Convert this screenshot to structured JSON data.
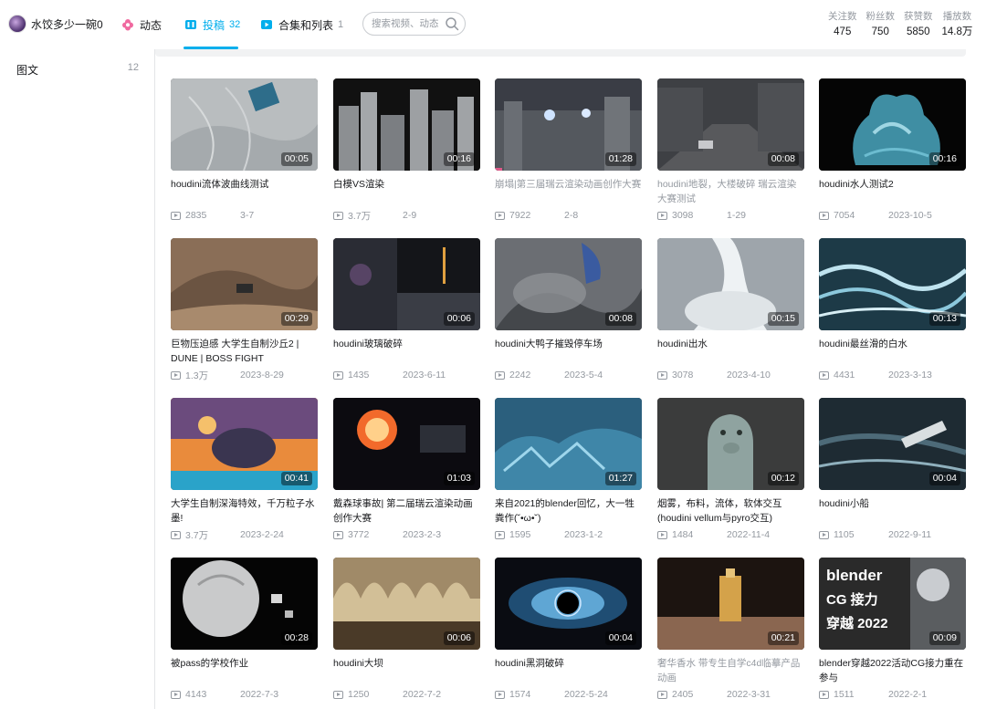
{
  "header": {
    "user_name": "水饺多少一碗0",
    "nav": [
      {
        "label": "动态",
        "count": ""
      },
      {
        "label": "投稿",
        "count": "32"
      },
      {
        "label": "合集和列表",
        "count": "1"
      }
    ],
    "search_placeholder": "搜索视频、动态",
    "stats": [
      {
        "label": "关注数",
        "value": "475"
      },
      {
        "label": "粉丝数",
        "value": "750"
      },
      {
        "label": "获赞数",
        "value": "5850"
      },
      {
        "label": "播放数",
        "value": "14.8万"
      }
    ],
    "colors": {
      "accent": "#00aeec",
      "secondary_text": "#9499a0"
    }
  },
  "sidebar": {
    "items": [
      {
        "label": "图文",
        "count": "12"
      }
    ]
  },
  "videos": [
    {
      "title": "houdini流体波曲线测试",
      "duration": "00:05",
      "views": "2835",
      "date": "3-7"
    },
    {
      "title": "白模VS渲染",
      "duration": "00:16",
      "views": "3.7万",
      "date": "2-9"
    },
    {
      "title": "崩塌|第三届瑞云渲染动画创作大赛",
      "duration": "01:28",
      "views": "7922",
      "date": "2-8"
    },
    {
      "title": "houdini地裂，大楼破碎 瑞云渲染大赛测试",
      "duration": "00:08",
      "views": "3098",
      "date": "1-29"
    },
    {
      "title": "houdini水人测试2",
      "duration": "00:16",
      "views": "7054",
      "date": "2023-10-5"
    },
    {
      "title": "巨物压迫感 大学生自制沙丘2 | DUNE | BOSS FIGHT",
      "duration": "00:29",
      "views": "1.3万",
      "date": "2023-8-29"
    },
    {
      "title": "houdini玻璃破碎",
      "duration": "00:06",
      "views": "1435",
      "date": "2023-6-11"
    },
    {
      "title": "houdini大鸭子摧毁停车场",
      "duration": "00:08",
      "views": "2242",
      "date": "2023-5-4"
    },
    {
      "title": "houdini出水",
      "duration": "00:15",
      "views": "3078",
      "date": "2023-4-10"
    },
    {
      "title": "houdini最丝滑的白水",
      "duration": "00:13",
      "views": "4431",
      "date": "2023-3-13"
    },
    {
      "title": "大学生自制深海特效，千万粒子水墨!",
      "duration": "00:41",
      "views": "3.7万",
      "date": "2023-2-24"
    },
    {
      "title": "戴森球事故| 第二届瑞云渲染动画创作大赛",
      "duration": "01:03",
      "views": "3772",
      "date": "2023-2-3"
    },
    {
      "title": "来自2021的blender回忆，大一牲粪作(˘•ω•˘)",
      "duration": "01:27",
      "views": "1595",
      "date": "2023-1-2"
    },
    {
      "title": "烟雾，布料，流体，软体交互(houdini vellum与pyro交互)",
      "duration": "00:12",
      "views": "1484",
      "date": "2022-11-4"
    },
    {
      "title": "houdini小船",
      "duration": "00:04",
      "views": "1105",
      "date": "2022-9-11"
    },
    {
      "title": "被pass的学校作业",
      "duration": "00:28",
      "views": "4143",
      "date": "2022-7-3"
    },
    {
      "title": "houdini大坝",
      "duration": "00:06",
      "views": "1250",
      "date": "2022-7-2"
    },
    {
      "title": "houdini黑洞破碎",
      "duration": "00:04",
      "views": "1574",
      "date": "2022-5-24"
    },
    {
      "title": "奢华香水 带专生自学c4d临摹产品动画",
      "duration": "00:21",
      "views": "2405",
      "date": "2022-3-31"
    },
    {
      "title": "blender穿越2022活动CG接力重在参与",
      "duration": "00:09",
      "views": "1511",
      "date": "2022-2-1"
    }
  ],
  "thumb_overlay_text": [
    "blender",
    "CG 接力",
    "穿越 2022"
  ]
}
